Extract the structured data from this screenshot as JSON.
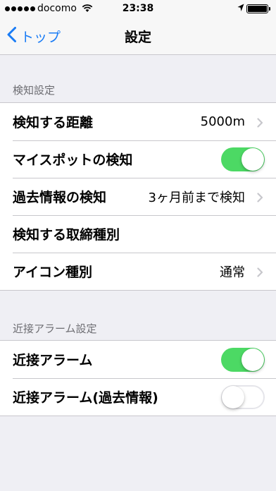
{
  "status_bar": {
    "carrier": "docomo",
    "time": "23:38",
    "signal_bars": 5,
    "battery_level": 1.0
  },
  "nav": {
    "back_label": "トップ",
    "title": "設定"
  },
  "sections": [
    {
      "header": "検知設定",
      "rows": [
        {
          "label": "検知する距離",
          "value": "5000m",
          "accessory": "chevron"
        },
        {
          "label": "マイスポットの検知",
          "accessory": "toggle",
          "toggle_on": true
        },
        {
          "label": "過去情報の検知",
          "value": "3ヶ月前まで検知",
          "accessory": "chevron"
        },
        {
          "label": "検知する取締種別",
          "accessory": "none"
        },
        {
          "label": "アイコン種別",
          "value": "通常",
          "accessory": "chevron"
        }
      ]
    },
    {
      "header": "近接アラーム設定",
      "rows": [
        {
          "label": "近接アラーム",
          "accessory": "toggle",
          "toggle_on": true
        },
        {
          "label": "近接アラーム(過去情報)",
          "accessory": "toggle",
          "toggle_on": false
        }
      ]
    }
  ],
  "colors": {
    "accent": "#1a7cf5",
    "toggle_on": "#4cd964",
    "background": "#efeff4",
    "section_header": "#6d6d72"
  }
}
